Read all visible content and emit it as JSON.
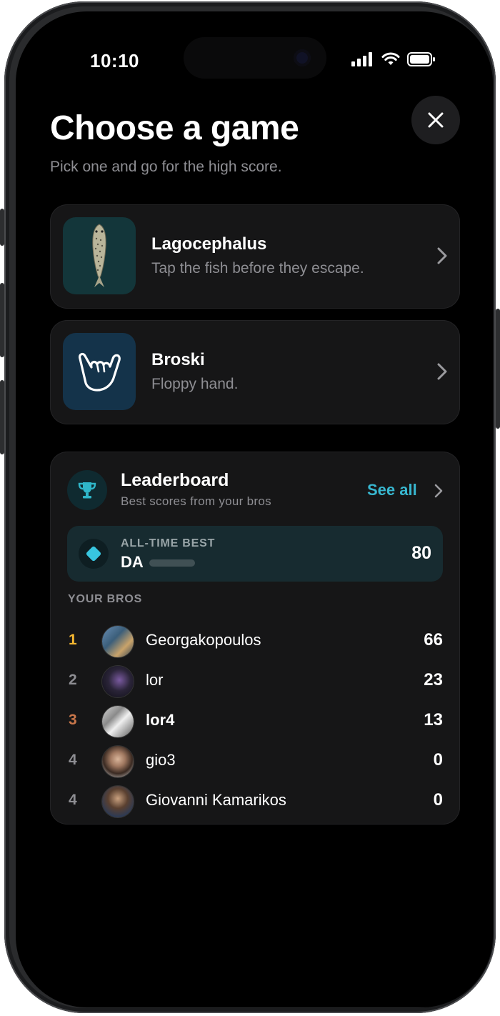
{
  "status_bar": {
    "time": "10:10"
  },
  "header": {
    "title": "Choose a game",
    "subtitle": "Pick one and go for the high score."
  },
  "games": [
    {
      "name": "Lagocephalus",
      "description": "Tap the fish before they escape.",
      "icon": "pufferfish-icon",
      "thumb_color": "#13363a"
    },
    {
      "name": "Broski",
      "description": "Floppy hand.",
      "icon": "shaka-hand-icon",
      "thumb_color": "#14334a"
    }
  ],
  "leaderboard": {
    "title": "Leaderboard",
    "subtitle": "Best scores from your bros",
    "see_all": "See all",
    "all_time_best": {
      "label": "ALL-TIME BEST",
      "name": "DA",
      "score": "80"
    },
    "bros_label": "YOUR BROS",
    "rows": [
      {
        "rank": "1",
        "name": "Georgakopoulos",
        "score": "66",
        "rank_color": "#f5b731",
        "bold": false
      },
      {
        "rank": "2",
        "name": "lor",
        "score": "23",
        "rank_color": "#8e8e93",
        "bold": false
      },
      {
        "rank": "3",
        "name": "lor4",
        "score": "13",
        "rank_color": "#c8764a",
        "bold": true
      },
      {
        "rank": "4",
        "name": "gio3",
        "score": "0",
        "rank_color": "#8e8e93",
        "bold": false
      },
      {
        "rank": "4",
        "name": "Giovanni Kamarikos",
        "score": "0",
        "rank_color": "#8e8e93",
        "bold": false
      }
    ]
  },
  "colors": {
    "accent": "#38b7d0",
    "card": "#161617",
    "background": "#000000"
  }
}
